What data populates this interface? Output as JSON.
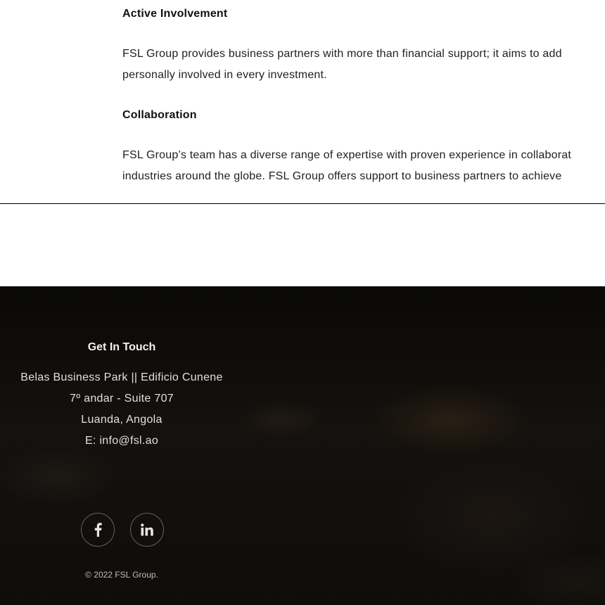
{
  "sections": [
    {
      "heading": "Active Involvement",
      "lines": [
        "FSL Group provides business partners with more than financial support; it aims to add",
        "personally involved in every investment."
      ]
    },
    {
      "heading": "Collaboration",
      "lines": [
        "FSL Group’s team has a diverse range of expertise with proven experience in collaborat",
        "industries around the globe. FSL Group offers support to business partners to achieve"
      ]
    }
  ],
  "footer": {
    "title": "Get In Touch",
    "address": [
      "Belas Business Park || Edificio Cunene",
      "7º andar - Suite 707",
      "Luanda, Angola"
    ],
    "email_prefix": "E: ",
    "email": "info@fsl.ao",
    "social": [
      {
        "icon": "facebook-icon"
      },
      {
        "icon": "linkedin-icon"
      }
    ],
    "copyright": "© 2022 FSL Group.",
    "colors": {
      "background": "#0d0b09",
      "text": "#e0e0e0"
    }
  }
}
